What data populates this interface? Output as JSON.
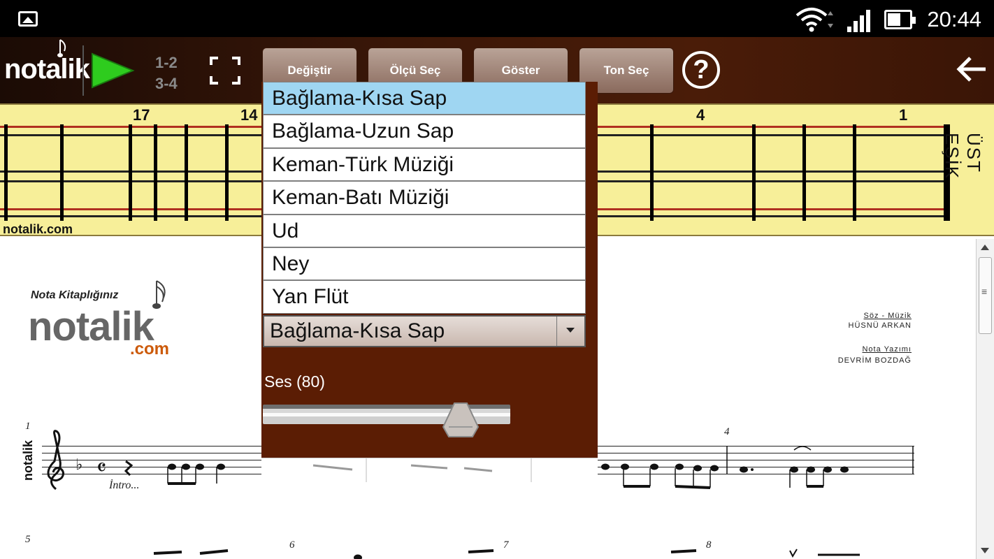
{
  "status_bar": {
    "time": "20:44"
  },
  "toolbar": {
    "logo": "notalik",
    "measure_label_top": "1-2",
    "measure_label_bottom": "3-4",
    "buttons": {
      "change": "Değiştir",
      "measure_select": "Ölçü Seç",
      "show": "Göster",
      "tone_select": "Ton Seç"
    },
    "help_label": "?"
  },
  "fretboard": {
    "fret_numbers": [
      "17",
      "14",
      "4",
      "1"
    ],
    "url": "notalik.com",
    "nut_label": "ÜST EŞİK"
  },
  "instrument_dropdown": {
    "options": [
      "Bağlama-Kısa Sap",
      "Bağlama-Uzun Sap",
      "Keman-Türk Müziği",
      "Keman-Batı Müziği",
      "Ud",
      "Ney",
      "Yan Flüt"
    ],
    "selected_index": 0,
    "selected_value": "Bağlama-Kısa Sap"
  },
  "volume": {
    "label": "Ses (80)",
    "value": 80,
    "max": 100
  },
  "sheet": {
    "brand_tagline": "Nota Kitaplığınız",
    "brand_name": "notalik",
    "brand_domain": ".com",
    "credits": {
      "lyrics_music_label": "Söz - Müzik",
      "composer": "HÜSNÜ ARKAN",
      "notation_label": "Nota Yazımı",
      "notation_by": "DEVRİM BOZDAĞ"
    },
    "side_label": "notalik",
    "intro": "İntro...",
    "measure_numbers": [
      "1",
      "4",
      "5",
      "6",
      "7",
      "8"
    ]
  },
  "colors": {
    "toolbar_bg": "#3a1708",
    "fretboard_bg": "#f7ef99",
    "panel_bg": "#5b1d04",
    "selected_item": "#9fd6f2",
    "play_green": "#2ecc1e",
    "brand_orange": "#cc5a0a"
  }
}
